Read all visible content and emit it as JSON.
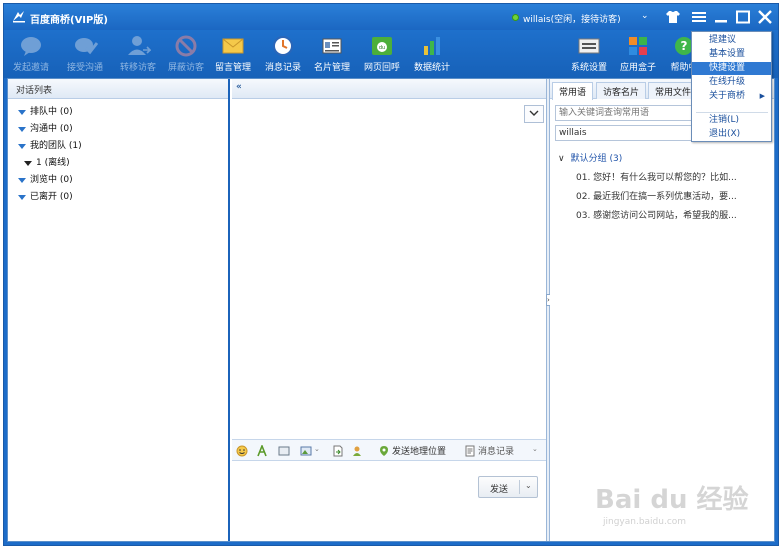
{
  "window": {
    "title": "百度商桥(VIP版)",
    "status_user": "willais(空闲，接待访客)",
    "status_caret": "⌄"
  },
  "toolbar": {
    "items": [
      {
        "label": "发起邀请",
        "icon": "chat-bubble-icon",
        "enabled": false
      },
      {
        "label": "接受沟通",
        "icon": "chat-accept-icon",
        "enabled": false
      },
      {
        "label": "转移访客",
        "icon": "user-transfer-icon",
        "enabled": false
      },
      {
        "label": "屏蔽访客",
        "icon": "block-icon",
        "enabled": false
      },
      {
        "label": "留言管理",
        "icon": "envelope-icon",
        "enabled": true
      },
      {
        "label": "消息记录",
        "icon": "clock-icon",
        "enabled": true
      },
      {
        "label": "名片管理",
        "icon": "card-icon",
        "enabled": true
      },
      {
        "label": "网页回呼",
        "icon": "callback-icon",
        "enabled": true
      },
      {
        "label": "数据统计",
        "icon": "bar-chart-icon",
        "enabled": true
      },
      {
        "label": "系统设置",
        "icon": "settings-icon",
        "enabled": true
      },
      {
        "label": "应用盒子",
        "icon": "app-box-icon",
        "enabled": true
      },
      {
        "label": "帮助中",
        "icon": "help-icon",
        "enabled": true
      }
    ]
  },
  "left_panel": {
    "header": "对话列表",
    "tree": [
      {
        "label": "排队中 (0)",
        "sub": false
      },
      {
        "label": "沟通中 (0)",
        "sub": false
      },
      {
        "label": "我的团队 (1)",
        "sub": false
      },
      {
        "label": "1 (离线)",
        "sub": true
      },
      {
        "label": "浏览中 (0)",
        "sub": false
      },
      {
        "label": "已离开 (0)",
        "sub": false
      }
    ]
  },
  "middle_panel": {
    "collapse_label": "«",
    "send_geo": "发送地理位置",
    "message_log": "消息记录",
    "send_button": "发送"
  },
  "right_panel": {
    "tabs": [
      "常用语",
      "访客名片",
      "常用文件"
    ],
    "search_placeholder": "输入关键词查询常用语",
    "user_select": "willais",
    "group": "默认分组 (3)",
    "phrases": [
      "01. 您好！有什么我可以帮您的？比如...",
      "02. 最近我们在搞一系列优惠活动，要...",
      "03. 感谢您访问公司网站，希望我的服..."
    ]
  },
  "menu": {
    "items": [
      {
        "label": "提建议",
        "highlight": false,
        "submenu": false
      },
      {
        "label": "基本设置",
        "highlight": false,
        "submenu": false
      },
      {
        "label": "快捷设置",
        "highlight": true,
        "submenu": false
      },
      {
        "label": "在线升级",
        "highlight": false,
        "submenu": false
      },
      {
        "label": "关于商桥",
        "highlight": false,
        "submenu": true
      },
      {
        "label": "注销(L)",
        "highlight": false,
        "submenu": false
      },
      {
        "label": "退出(X)",
        "highlight": false,
        "submenu": false
      }
    ]
  },
  "watermark": {
    "brand": "Bai du 经验",
    "url": "jingyan.baidu.com"
  },
  "colors": {
    "titlebar": "#1d6cc8",
    "menu_highlight": "#2f79d2",
    "status_online": "#6fd13c"
  }
}
